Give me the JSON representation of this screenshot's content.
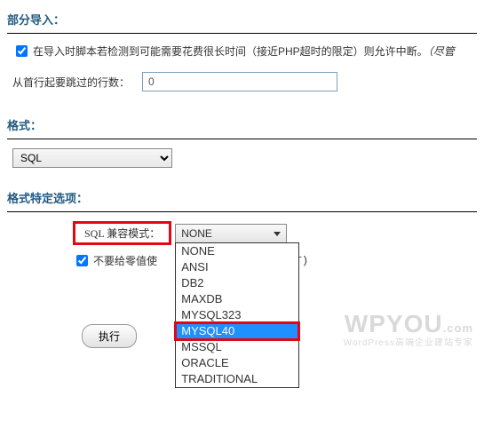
{
  "sections": {
    "partial_import": "部分导入：",
    "format": "格式：",
    "format_options": "格式特定选项："
  },
  "partial": {
    "interrupt_text": "在导入时脚本若检测到可能需要花费很长时间（接近PHP超时的限定）则允许中断。",
    "interrupt_suffix": "（尽管",
    "skip_label": "从首行起要跳过的行数：",
    "skip_value": "0"
  },
  "format_select": {
    "value": "SQL"
  },
  "compat": {
    "label": "SQL 兼容模式：",
    "selected": "NONE",
    "options": [
      "NONE",
      "ANSI",
      "DB2",
      "MAXDB",
      "MYSQL323",
      "MYSQL40",
      "MSSQL",
      "ORACLE",
      "TRADITIONAL"
    ],
    "highlight": "MYSQL40"
  },
  "zero": {
    "label": "不要给零值使",
    "code": "MENT)"
  },
  "exec_label": "执行",
  "watermark": {
    "big": "WPYOU",
    "suffix": ".com",
    "small": "WordPress高端企业建站专家"
  }
}
